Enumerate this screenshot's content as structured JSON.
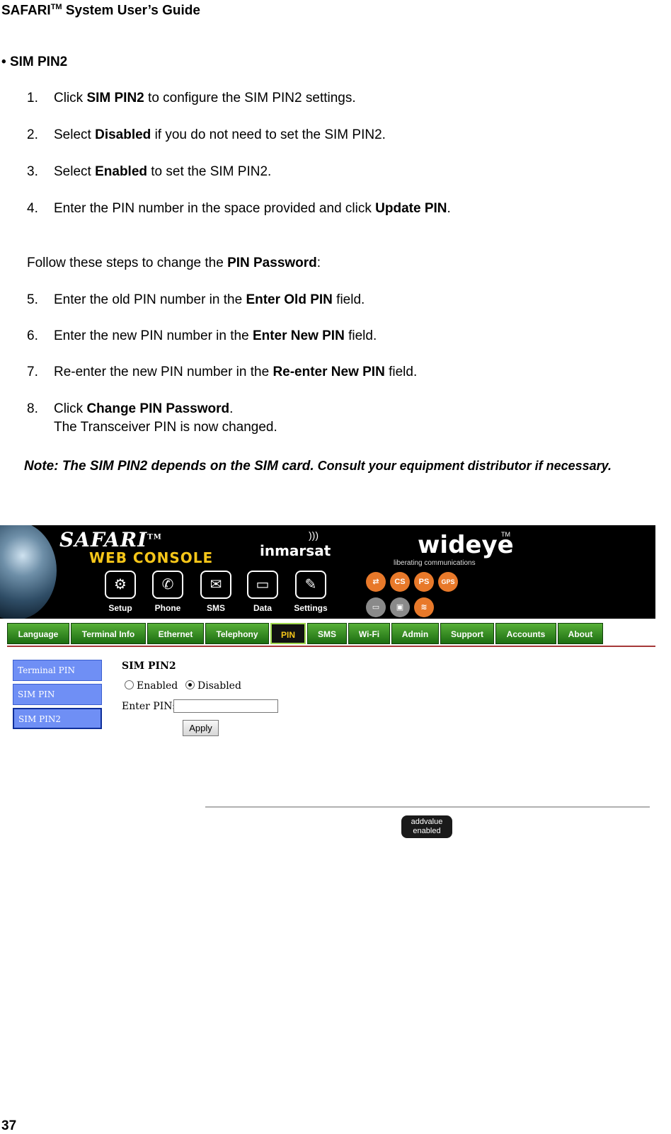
{
  "header": {
    "title": "SAFARI",
    "tm": "TM",
    "subtitle": "System User’s Guide"
  },
  "section": {
    "bullet": "•",
    "title": "SIM PIN2"
  },
  "steps_a": [
    {
      "num": "1.",
      "pre": "Click ",
      "bold": "SIM PIN2",
      "post": " to configure the SIM PIN2 settings."
    },
    {
      "num": "2.",
      "pre": "Select ",
      "bold": "Disabled",
      "post": " if you do not need to set the SIM PIN2."
    },
    {
      "num": "3.",
      "pre": "Select ",
      "bold": "Enabled",
      "post": " to set the SIM PIN2."
    },
    {
      "num": "4.",
      "pre": "Enter the PIN number in the space provided and click ",
      "bold": "Update PIN",
      "post": "."
    }
  ],
  "intro": {
    "pre": "Follow these steps to change the ",
    "bold": "PIN Password",
    "post": ":"
  },
  "steps_b": [
    {
      "num": "5.",
      "pre": "Enter the old PIN number in the ",
      "bold": "Enter Old PIN",
      "post": " field."
    },
    {
      "num": "6.",
      "pre": "Enter the new PIN number in the ",
      "bold": "Enter New PIN",
      "post": " field."
    },
    {
      "num": "7.",
      "pre": "Re-enter the new PIN number in the ",
      "bold": "Re-enter New PIN",
      "post": " field."
    },
    {
      "num": "8.",
      "pre": "Click ",
      "bold": "Change PIN Password",
      "post": ".",
      "line2": "The Transceiver PIN is now changed."
    }
  ],
  "note": {
    "lead": "Note: The SIM PIN2 depends on the SIM card.",
    "rest": " Consult your equipment distributor if necessary."
  },
  "page_number": "37",
  "console": {
    "brand": {
      "safari": "SAFARI",
      "tm": "TM",
      "web_console": "WEB CONSOLE",
      "inmarsat": "inmarsat",
      "wideye": "wideye",
      "wideye_tm": "TM",
      "tagline": "liberating communications"
    },
    "nav": [
      {
        "label": "Setup",
        "icon": "setup-icon"
      },
      {
        "label": "Phone",
        "icon": "phone-icon"
      },
      {
        "label": "SMS",
        "icon": "sms-envelope-icon"
      },
      {
        "label": "Data",
        "icon": "data-computer-icon"
      },
      {
        "label": "Settings",
        "icon": "settings-tools-icon"
      }
    ],
    "status_icons": [
      {
        "text": "⇄",
        "icon": "connection-status-icon",
        "color": "#e8792a"
      },
      {
        "text": "CS",
        "icon": "cs-status-icon",
        "color": "#e8792a"
      },
      {
        "text": "PS",
        "icon": "ps-status-icon",
        "color": "#e8792a"
      },
      {
        "text": "GPS",
        "icon": "gps-status-icon",
        "color": "#e8792a"
      },
      {
        "text": "▭",
        "icon": "computer-status-icon",
        "color": "#8a8a8a"
      },
      {
        "text": "▣",
        "icon": "lock-status-icon",
        "color": "#8a8a8a"
      },
      {
        "text": "≋",
        "icon": "wifi-status-icon",
        "color": "#e8792a"
      }
    ],
    "tabs": [
      "Language",
      "Terminal Info",
      "Ethernet",
      "Telephony",
      "PIN",
      "SMS",
      "Wi-Fi",
      "Admin",
      "Support",
      "Accounts",
      "About"
    ],
    "active_tab": "PIN",
    "side_menu": [
      "Terminal PIN",
      "SIM PIN",
      "SIM PIN2"
    ],
    "selected_side": "SIM PIN2",
    "form": {
      "title": "SIM PIN2",
      "options": [
        "Enabled",
        "Disabled"
      ],
      "selected_option": "Disabled",
      "pin_label": "Enter PIN:",
      "pin_value": "",
      "apply_label": "Apply"
    },
    "footer_badge": {
      "line1": "addvalue",
      "line2": "enabled"
    }
  },
  "colors": {
    "tab_green": "#2f8a1e",
    "active_tab_text": "#f6c619",
    "side_menu_blue": "#6f8ff5",
    "rule_red": "#a53838"
  }
}
